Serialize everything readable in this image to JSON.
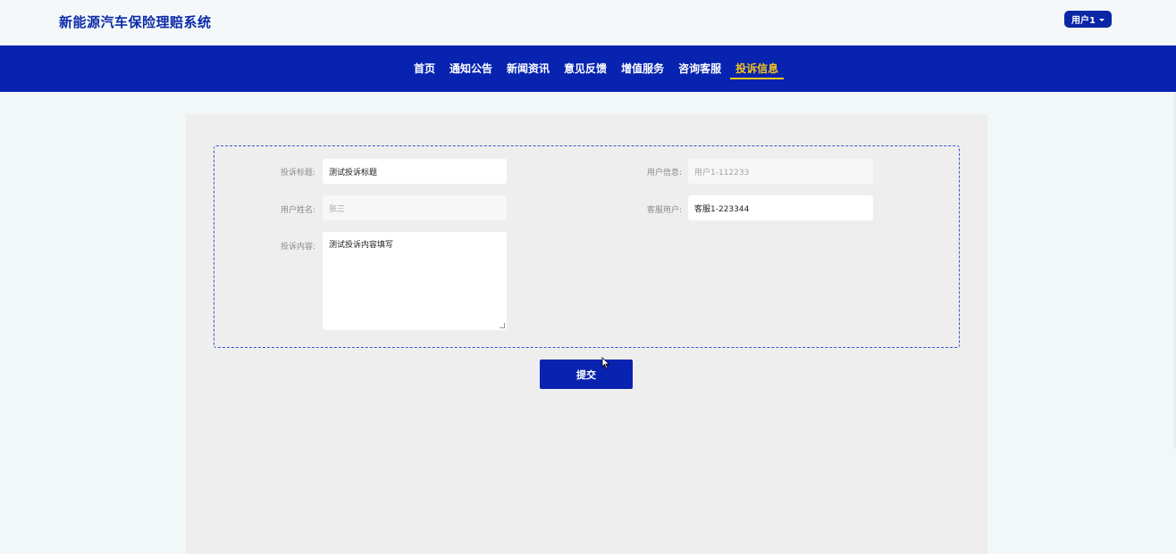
{
  "header": {
    "site_title": "新能源汽车保险理赔系统",
    "user_menu_label": "用户1"
  },
  "nav": {
    "items": [
      {
        "label": "首页",
        "active": false
      },
      {
        "label": "通知公告",
        "active": false
      },
      {
        "label": "新闻资讯",
        "active": false
      },
      {
        "label": "意见反馈",
        "active": false
      },
      {
        "label": "增值服务",
        "active": false
      },
      {
        "label": "咨询客服",
        "active": false
      },
      {
        "label": "投诉信息",
        "active": true
      }
    ]
  },
  "form": {
    "complaint_title": {
      "label": "投诉标题:",
      "value": "测试投诉标题"
    },
    "user_info": {
      "label": "用户信息:",
      "value": "用户1-112233"
    },
    "user_name": {
      "label": "用户姓名:",
      "value": "张三"
    },
    "service_user": {
      "label": "客服用户:",
      "value": "客服1-223344"
    },
    "complaint_content": {
      "label": "投诉内容:",
      "value": "测试投诉内容填写"
    },
    "submit_label": "提交"
  },
  "colors": {
    "brand": "#0723b0",
    "active_nav": "#f5c518",
    "panel_bg": "#eeeeee"
  }
}
